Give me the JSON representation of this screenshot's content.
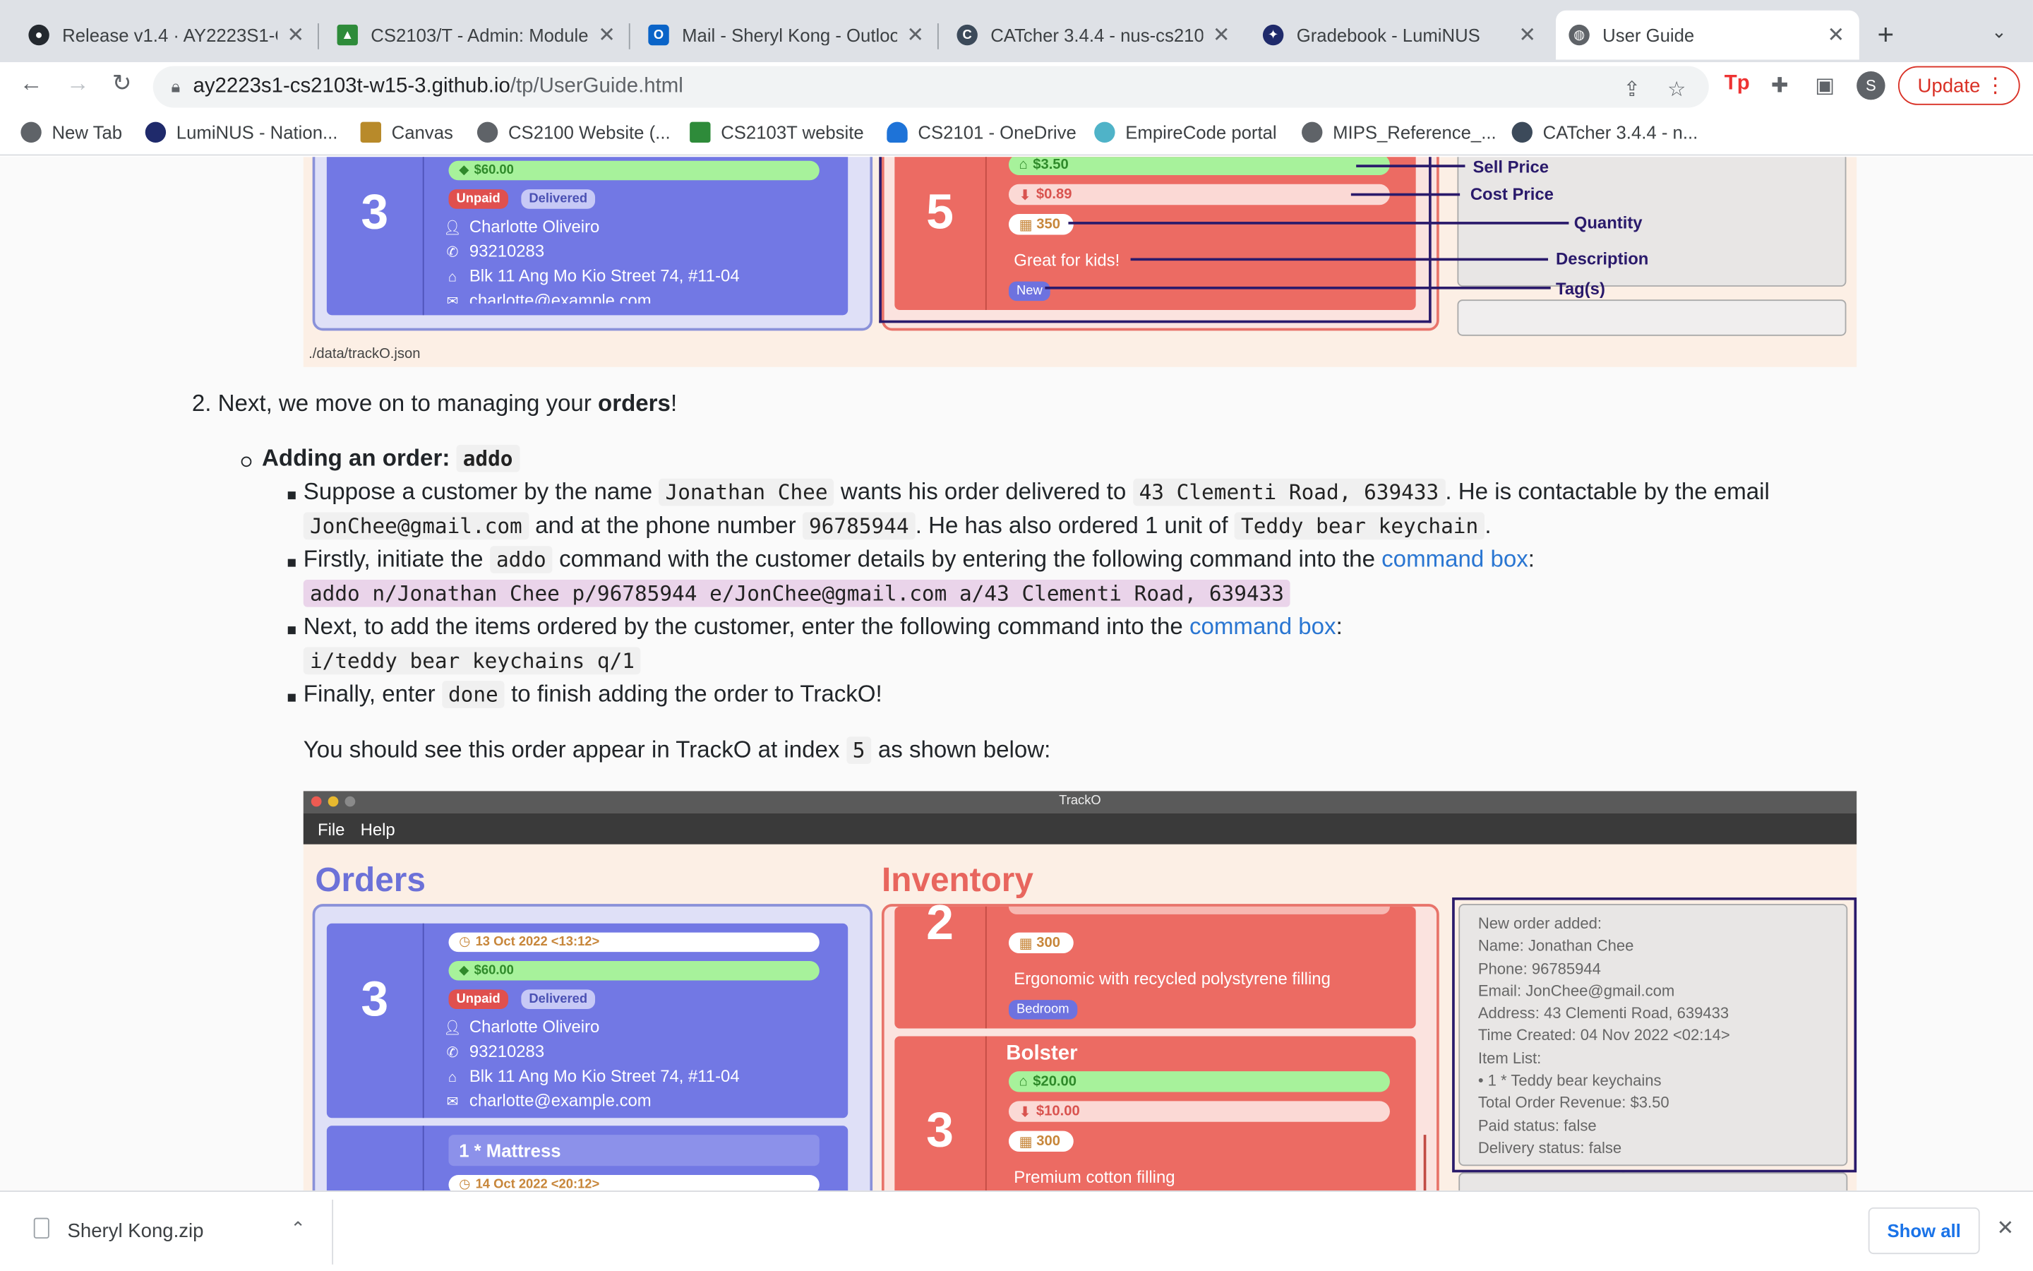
{
  "browser": {
    "tabs": [
      {
        "title": "Release v1.4 · AY2223S1-C",
        "icon": "github-icon"
      },
      {
        "title": "CS2103/T - Admin: Module",
        "icon": "graduation-cap-icon"
      },
      {
        "title": "Mail - Sheryl Kong - Outloo",
        "icon": "outlook-icon"
      },
      {
        "title": "CATcher 3.4.4 - nus-cs210",
        "icon": "catcher-icon"
      },
      {
        "title": "Gradebook - LumiNUS",
        "icon": "luminus-icon"
      },
      {
        "title": "User Guide",
        "icon": "globe-icon"
      }
    ],
    "url_host": "ay2223s1-cs2103t-w15-3.github.io",
    "url_path": "/tp/UserGuide.html",
    "profile_initial": "S",
    "update_label": "Update",
    "bookmarks": [
      "New Tab",
      "LumiNUS - Nation...",
      "Canvas",
      "CS2100 Website (...",
      "CS2103T website",
      "CS2101 - OneDrive",
      "EmpireCode portal",
      "MIPS_Reference_...",
      "CATcher 3.4.4 - n..."
    ]
  },
  "figure_top": {
    "order": {
      "index": "3",
      "price": "$60.00",
      "unpaid": "Unpaid",
      "delivered": "Delivered",
      "name": "Charlotte Oliveiro",
      "phone": "93210283",
      "address": "Blk 11 Ang Mo Kio Street 74, #11-04",
      "email": "charlotte@example.com"
    },
    "inventory": {
      "index": "5",
      "sell": "$3.50",
      "cost": "$0.89",
      "qty": "350",
      "description": "Great for kids!",
      "tag": "New"
    },
    "annotations": [
      "Sell Price",
      "Cost Price",
      "Quantity",
      "Description",
      "Tag(s)"
    ],
    "path": "./data/trackO.json"
  },
  "doc": {
    "step2_prefix": "2. Next, we move on to managing your ",
    "step2_bold": "orders",
    "step2_suffix": "!",
    "adding_title": "Adding an order:",
    "adding_cmd": "addo",
    "b1_a": "Suppose a customer by the name ",
    "b1_name": "Jonathan Chee",
    "b1_b": " wants his order delivered to ",
    "b1_addr": "43 Clementi Road, 639433",
    "b1_c": ". He is contactable by the email",
    "b1_email": "JonChee@gmail.com",
    "b1_d": " and at the phone number ",
    "b1_phone": "96785944",
    "b1_e": ". He has also ordered 1 unit of ",
    "b1_item": "Teddy bear keychain",
    "b1_f": ".",
    "b2_a": "Firstly, initiate the ",
    "b2_cmd": "addo",
    "b2_b": " command with the customer details by entering the following command into the ",
    "b2_link": "command box",
    "b2_c": ":",
    "b2_code": "addo n/Jonathan Chee p/96785944 e/JonChee@gmail.com a/43 Clementi Road, 639433",
    "b3_a": "Next, to add the items ordered by the customer, enter the following command into the ",
    "b3_link": "command box",
    "b3_b": ":",
    "b3_code": "i/teddy bear keychains q/1",
    "b4_a": "Finally, enter ",
    "b4_cmd": "done",
    "b4_b": " to finish adding the order to TrackO!",
    "see_a": "You should see this order appear in TrackO at index ",
    "see_idx": "5",
    "see_b": " as shown below:"
  },
  "figure_bottom": {
    "app_title": "TrackO",
    "menu_file": "File",
    "menu_help": "Help",
    "orders_heading": "Orders",
    "inventory_heading": "Inventory",
    "order1": {
      "index": "3",
      "date": "13 Oct 2022 <13:12>",
      "price": "$60.00",
      "unpaid": "Unpaid",
      "delivered": "Delivered",
      "name": "Charlotte Oliveiro",
      "phone": "93210283",
      "address": "Blk 11 Ang Mo Kio Street 74, #11-04",
      "email": "charlotte@example.com"
    },
    "order2": {
      "item": "1 * Mattress",
      "date": "14 Oct 2022 <20:12>"
    },
    "inv1": {
      "index": "2",
      "qty": "300",
      "description": "Ergonomic with recycled polystyrene filling",
      "tag": "Bedroom"
    },
    "inv2": {
      "index": "3",
      "name": "Bolster",
      "sell": "$20.00",
      "cost": "$10.00",
      "qty": "300",
      "description": "Premium cotton filling"
    },
    "result_lines": [
      "New order added:",
      "Name: Jonathan Chee",
      "Phone: 96785944",
      "Email: JonChee@gmail.com",
      "Address: 43 Clementi Road, 639433",
      "Time Created: 04 Nov 2022 <02:14>",
      "Item List:",
      "• 1 * Teddy bear keychains",
      "Total Order Revenue: $3.50",
      "Paid status: false",
      "Delivery status: false"
    ]
  },
  "downloads": {
    "file": "Sheryl Kong.zip",
    "show_all": "Show all"
  },
  "colors": {
    "order_card": "#7278e4",
    "inventory_card": "#ec6b63",
    "annotation": "#2a1a6b",
    "link": "#2a76d2"
  }
}
